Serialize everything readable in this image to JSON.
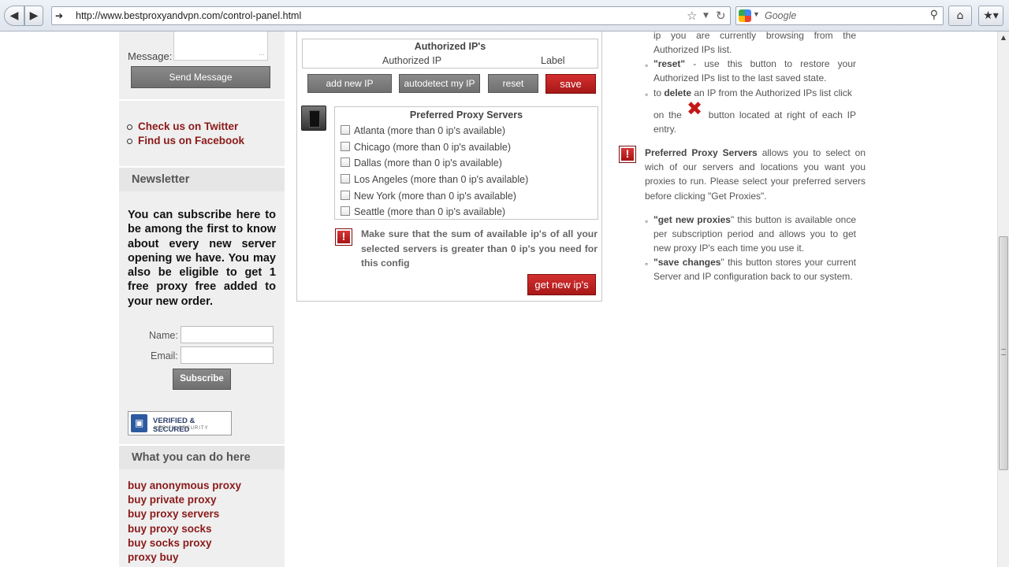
{
  "browser": {
    "url": "http://www.bestproxyandvpn.com/control-panel.html",
    "search_placeholder": "Google"
  },
  "sidebar": {
    "message_label": "Message:",
    "send_button": "Send Message",
    "social": [
      "Check us on Twitter",
      "Find us on Facebook"
    ],
    "newsletter_heading": "Newsletter",
    "newsletter_text": "You can subscribe here to be among the first to know about every new server opening we have. You may also be eligible to get 1 free proxy free added to your new order.",
    "name_label": "Name:",
    "email_label": "Email:",
    "subscribe_button": "Subscribe",
    "badge_line1": "VERIFIED & SECURED",
    "badge_line2": "VERIFY SECURITY",
    "what_heading": "What you can do here",
    "links": [
      "buy anonymous proxy",
      "buy private proxy",
      "buy proxy servers",
      "buy proxy socks",
      "buy socks proxy",
      "proxy buy"
    ]
  },
  "panel": {
    "authorized_title": "Authorized IP's",
    "col_ip": "Authorized IP",
    "col_label": "Label",
    "btn_add": "add new IP",
    "btn_autodetect": "autodetect my IP",
    "btn_reset": "reset",
    "btn_save": "save",
    "preferred_title": "Preferred Proxy Servers",
    "servers": [
      "Atlanta (more than 0 ip's available)",
      "Chicago (more than 0 ip's available)",
      "Dallas (more than 0 ip's available)",
      "Los Angeles (more than 0 ip's available)",
      "New York (more than 0 ip's available)",
      "Seattle (more than 0 ip's available)"
    ],
    "warning_text": "Make sure that the sum of available ip's of all your selected servers is greater than 0 ip's you need for this config",
    "btn_get_new": "get new ip's"
  },
  "help": {
    "line1": "ip you are currently browsing from the Authorized IPs list.",
    "reset_bold": "\"reset\"",
    "reset_text": " - use this button to restore your Authorized IPs list to the last saved state.",
    "delete_pre": "to ",
    "delete_bold": "delete",
    "delete_post": " an IP from the Authorized IPs list click",
    "delete_on": "on the",
    "delete_after": "button located at right of each IP entry.",
    "pref_bold": "Preferred Proxy Servers",
    "pref_text": " allows you to select on wich of our servers and locations you want you proxies to run. Please select your preferred servers before clicking \"Get Proxies\".",
    "getnew_bold": "\"get new proxies",
    "getnew_text": "\" this button is available once per subscription period and allows you to get new proxy IP's each time you use it.",
    "save_bold": "\"save changes",
    "save_text": "\" this button stores your current Server and IP configuration back to our system."
  }
}
